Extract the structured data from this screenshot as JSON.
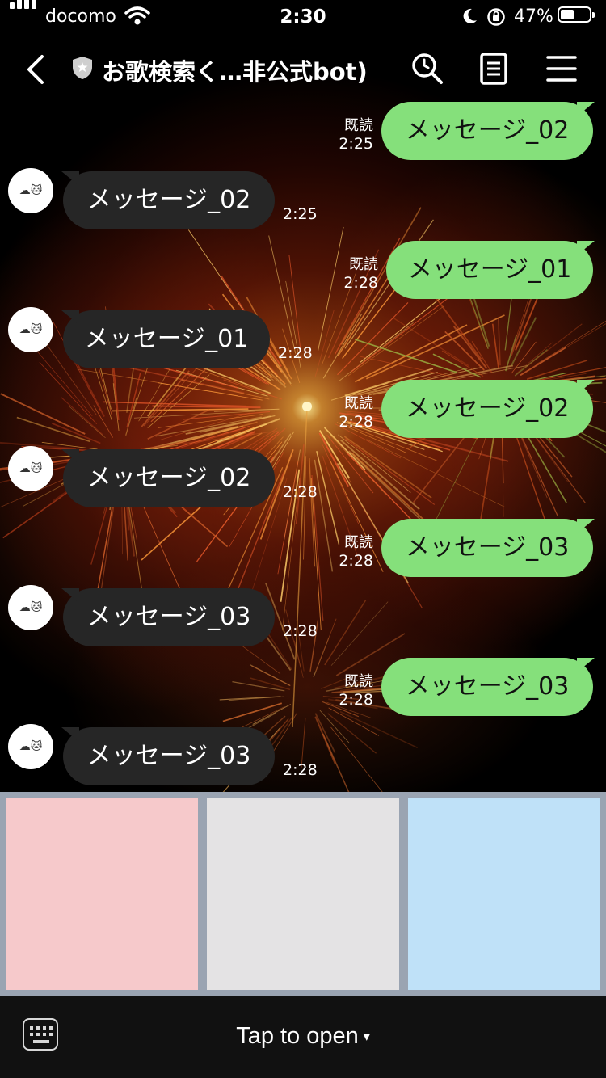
{
  "status_bar": {
    "carrier": "docomo",
    "time": "2:30",
    "battery_percent": "47%",
    "battery_level": 0.47
  },
  "header": {
    "title": "お歌検索く…非公式bot)",
    "icons": [
      "back-chevron-icon",
      "official-shield-icon",
      "search-icon",
      "notes-icon",
      "menu-icon"
    ]
  },
  "messages": [
    {
      "direction": "out",
      "text": "メッセージ_02",
      "read_label": "既読",
      "time": "2:25"
    },
    {
      "direction": "in",
      "text": "メッセージ_02",
      "time": "2:25"
    },
    {
      "direction": "out",
      "text": "メッセージ_01",
      "read_label": "既読",
      "time": "2:28"
    },
    {
      "direction": "in",
      "text": "メッセージ_01",
      "time": "2:28"
    },
    {
      "direction": "out",
      "text": "メッセージ_02",
      "read_label": "既読",
      "time": "2:28"
    },
    {
      "direction": "in",
      "text": "メッセージ_02",
      "time": "2:28"
    },
    {
      "direction": "out",
      "text": "メッセージ_03",
      "read_label": "既読",
      "time": "2:28"
    },
    {
      "direction": "in",
      "text": "メッセージ_03",
      "time": "2:28"
    },
    {
      "direction": "out",
      "text": "メッセージ_03",
      "read_label": "既読",
      "time": "2:28"
    },
    {
      "direction": "in",
      "text": "メッセージ_03",
      "time": "2:28"
    }
  ],
  "avatar": {
    "emoji": "☁🐱"
  },
  "rich_menu": {
    "panels": [
      {
        "color": "#f6c9cb"
      },
      {
        "color": "#e4e3e4"
      },
      {
        "color": "#bfe1f8"
      }
    ]
  },
  "bottom_bar": {
    "label": "Tap to open",
    "caret": "▾",
    "icon": "keyboard-icon"
  },
  "colors": {
    "outgoing_bubble": "#85e07b",
    "incoming_bubble": "#262626",
    "rich_menu_border": "#9aa4b2"
  }
}
